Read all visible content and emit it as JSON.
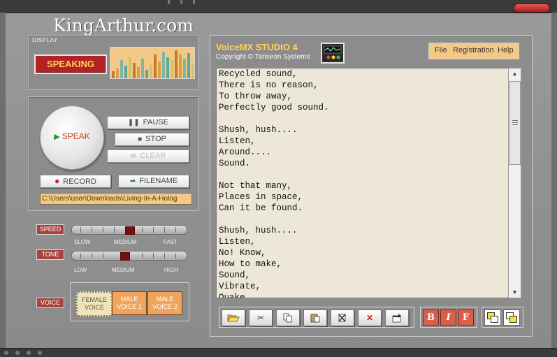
{
  "app": {
    "brand": "KingArthur.com"
  },
  "display": {
    "label": "DISPLAY",
    "status": "SPEAKING"
  },
  "controls": {
    "speak_label": "SPEAK",
    "pause_label": "PAUSE",
    "stop_label": "STOP",
    "clear_label": "CLEAR",
    "record_label": "RECORD",
    "filename_label": "FILENAME",
    "file_path": "C:\\Users\\user\\Downloads\\Living-In-A-Holog"
  },
  "speed": {
    "label": "SPEED",
    "slow": "SLOW",
    "medium": "MEDIUM",
    "fast": "FAST",
    "level": 0.5
  },
  "tone": {
    "label": "TONE",
    "low": "LOW",
    "medium": "MEDIUM",
    "high": "HIGH",
    "level": 0.45
  },
  "voice": {
    "label": "VOICE",
    "options": [
      {
        "label": "FEMALE VOICE",
        "selected": true
      },
      {
        "label": "MALE VOICE 1",
        "selected": false
      },
      {
        "label": "MALE VOICE 2",
        "selected": false
      }
    ]
  },
  "studio": {
    "title": "VoiceMX STUDIO 4",
    "copyright": "Copyright © Tanseon Systems",
    "menu": [
      "File",
      "Registration",
      "Help"
    ]
  },
  "editor": {
    "lines": [
      "Recycled sound,",
      "There is no reason,",
      "To throw away,",
      "Perfectly good sound.",
      "",
      "Shush, hush....",
      "Listen,",
      "Around....",
      "Sound.",
      "",
      "Not that many,",
      "Places in space,",
      "Can it be found.",
      "",
      "Shush, hush....",
      "Listen,",
      "No! Know,",
      "How to make,",
      "Sound,",
      "Vibrate,",
      "Quake"
    ]
  },
  "format": {
    "bold": "B",
    "italic": "I",
    "font": "F"
  },
  "colors": {
    "accent_orange": "#f3c98a",
    "record_red": "#b32222",
    "title_yellow": "#ffd35a"
  }
}
